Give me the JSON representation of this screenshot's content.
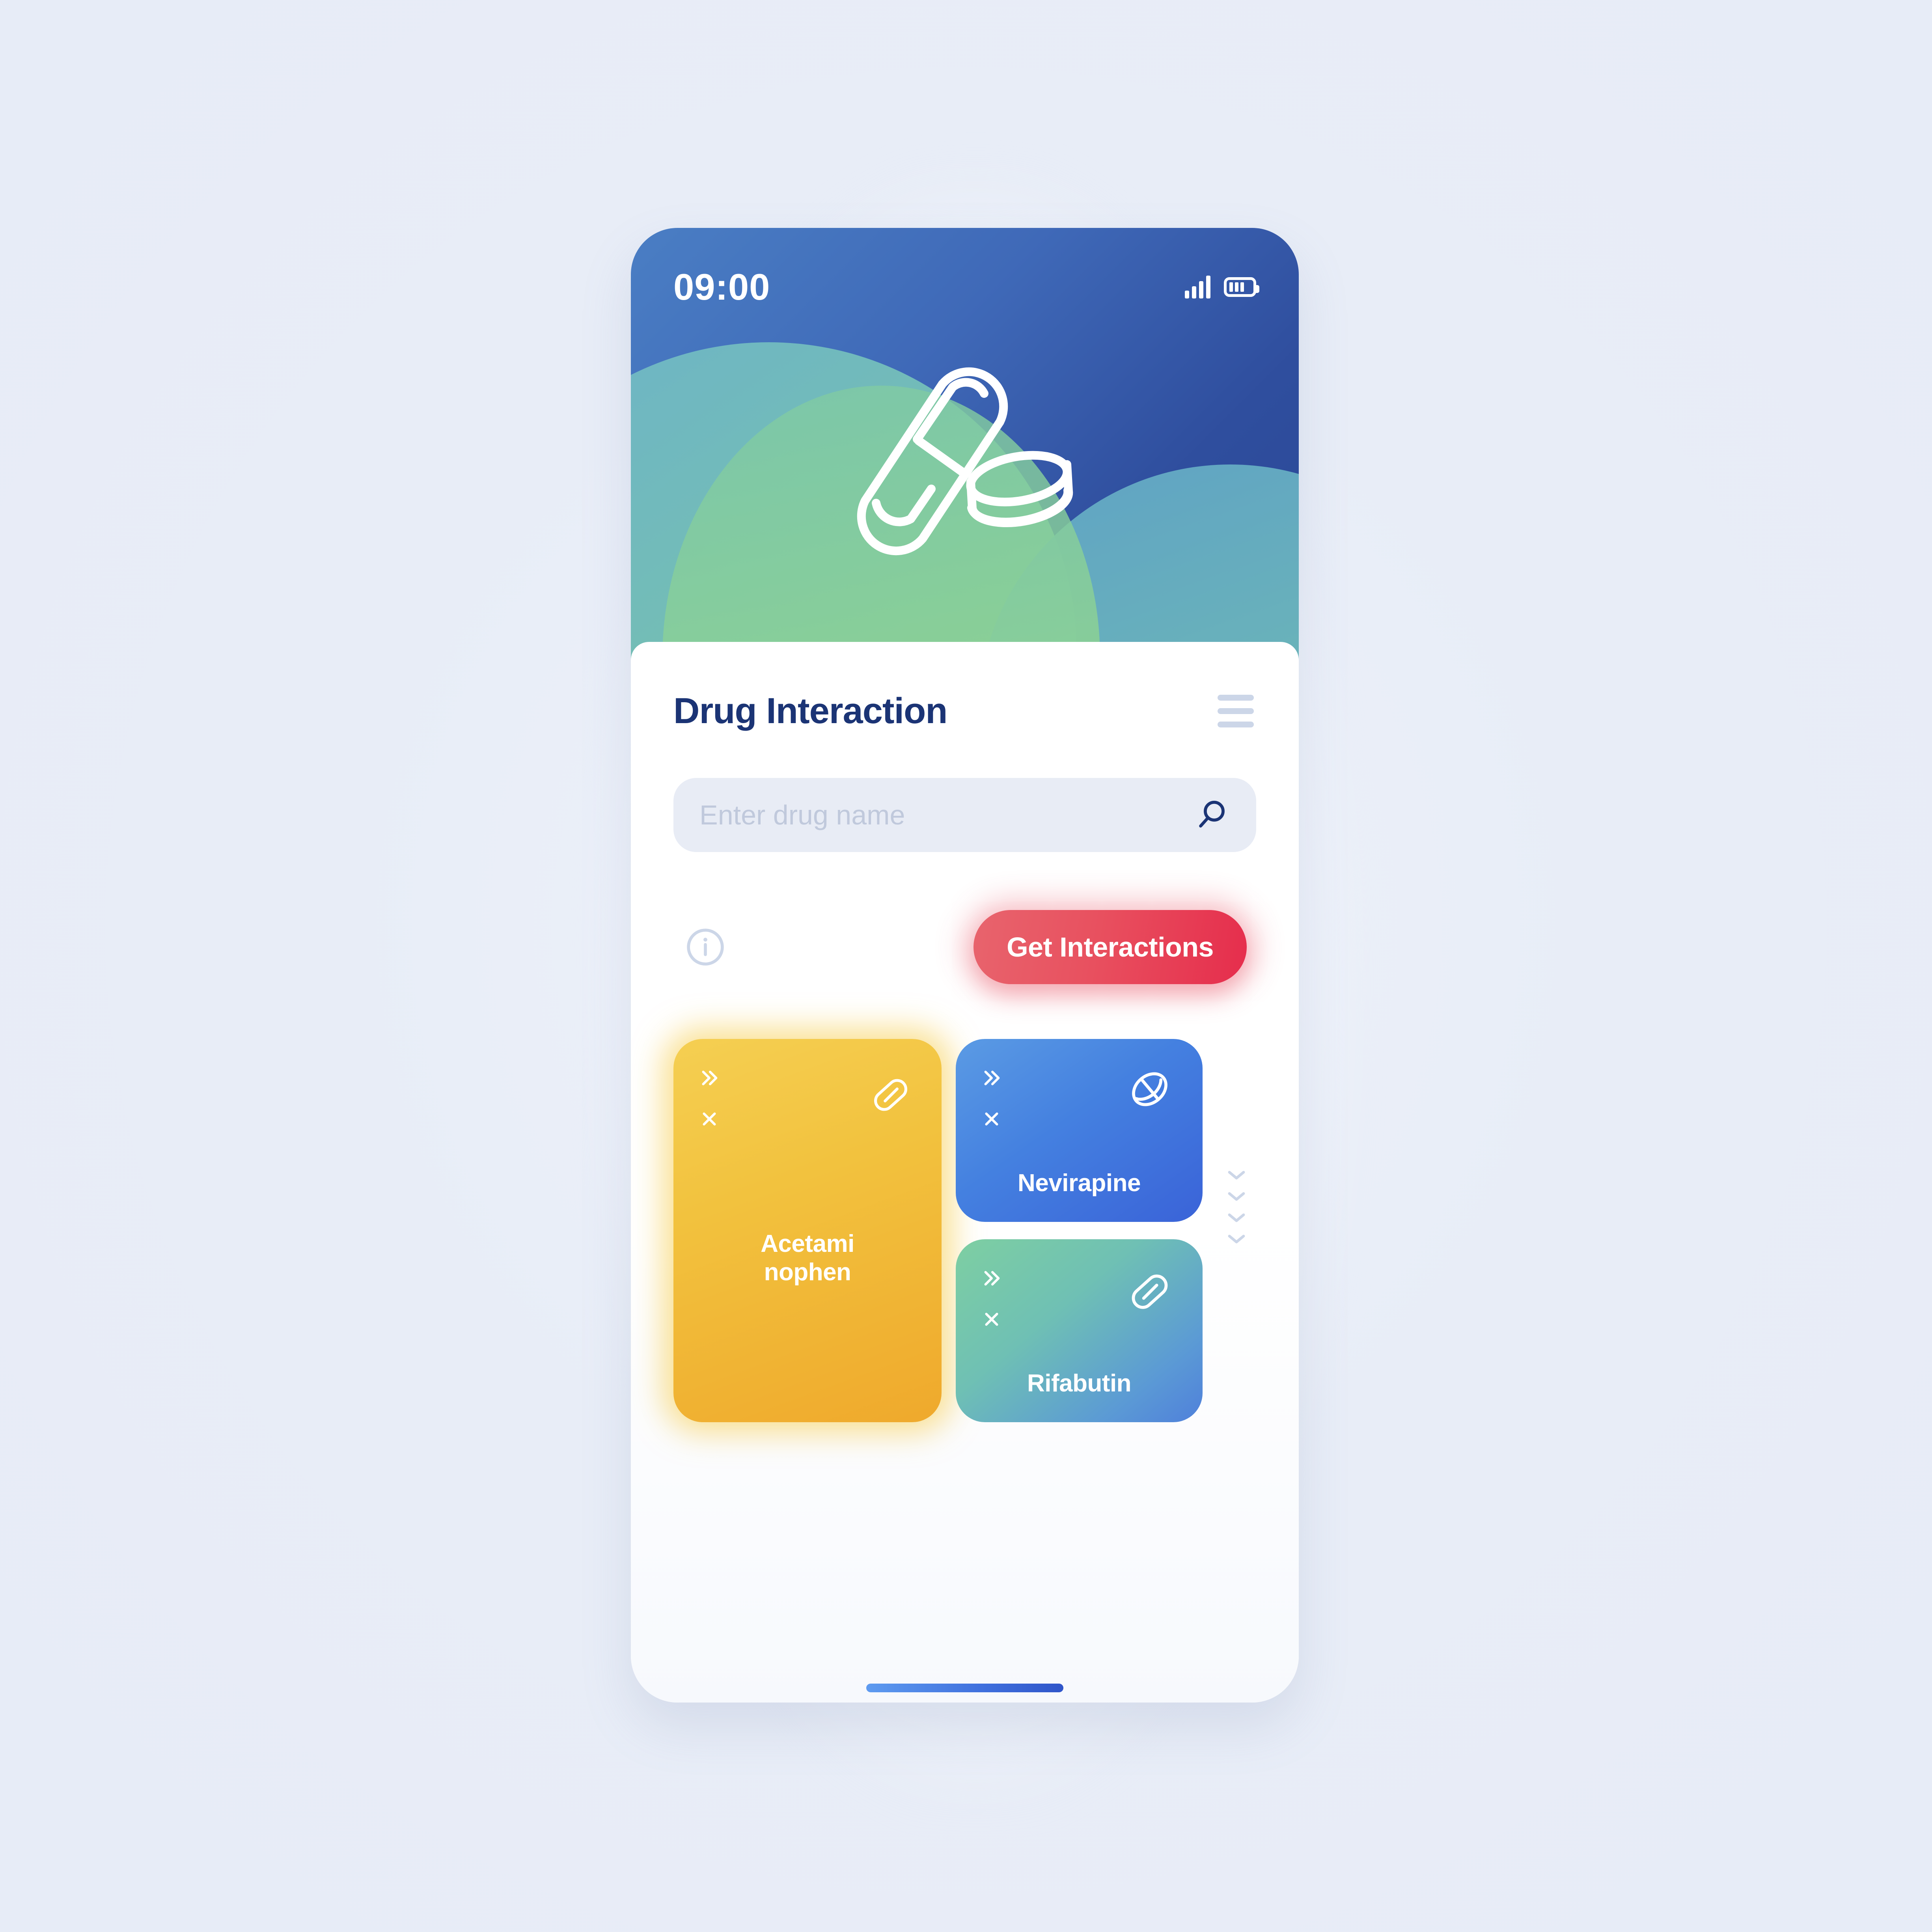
{
  "status_bar": {
    "time": "09:00",
    "signal_icon": "signal-bars-icon",
    "battery_icon": "battery-icon"
  },
  "hero": {
    "illustration": "pill-capsule-and-tablets-illustration"
  },
  "header": {
    "title": "Drug Interaction",
    "menu_icon": "hamburger-menu-icon"
  },
  "search": {
    "value": "",
    "placeholder": "Enter drug name",
    "icon": "search-icon"
  },
  "actions": {
    "info_icon": "info-circle-icon",
    "cta_label": "Get Interactions"
  },
  "cards": {
    "featured": {
      "label_line1": "Acetami",
      "label_line2": "nophen",
      "expand_icon": "double-chevron-right-icon",
      "remove_icon": "close-x-icon",
      "pill_icon": "capsule-pill-icon",
      "color": "#F2C23E"
    },
    "items": [
      {
        "label": "Nevirapine",
        "expand_icon": "double-chevron-right-icon",
        "remove_icon": "close-x-icon",
        "pill_icon": "round-tablet-icon",
        "color": "#4480E0"
      },
      {
        "label": "Rifabutin",
        "expand_icon": "double-chevron-right-icon",
        "remove_icon": "close-x-icon",
        "pill_icon": "capsule-pill-icon",
        "color": "#6FC0B4"
      }
    ],
    "scroll_hint_icon": "chevron-down-icon",
    "scroll_hint_count": 4
  },
  "home_indicator": "home-indicator-bar",
  "colors": {
    "title": "#1B3475",
    "cta": "#E8465A",
    "hero_blue": "#2F4E9E",
    "hero_green": "#8ED392",
    "page_bg": "#E9EEF8"
  }
}
